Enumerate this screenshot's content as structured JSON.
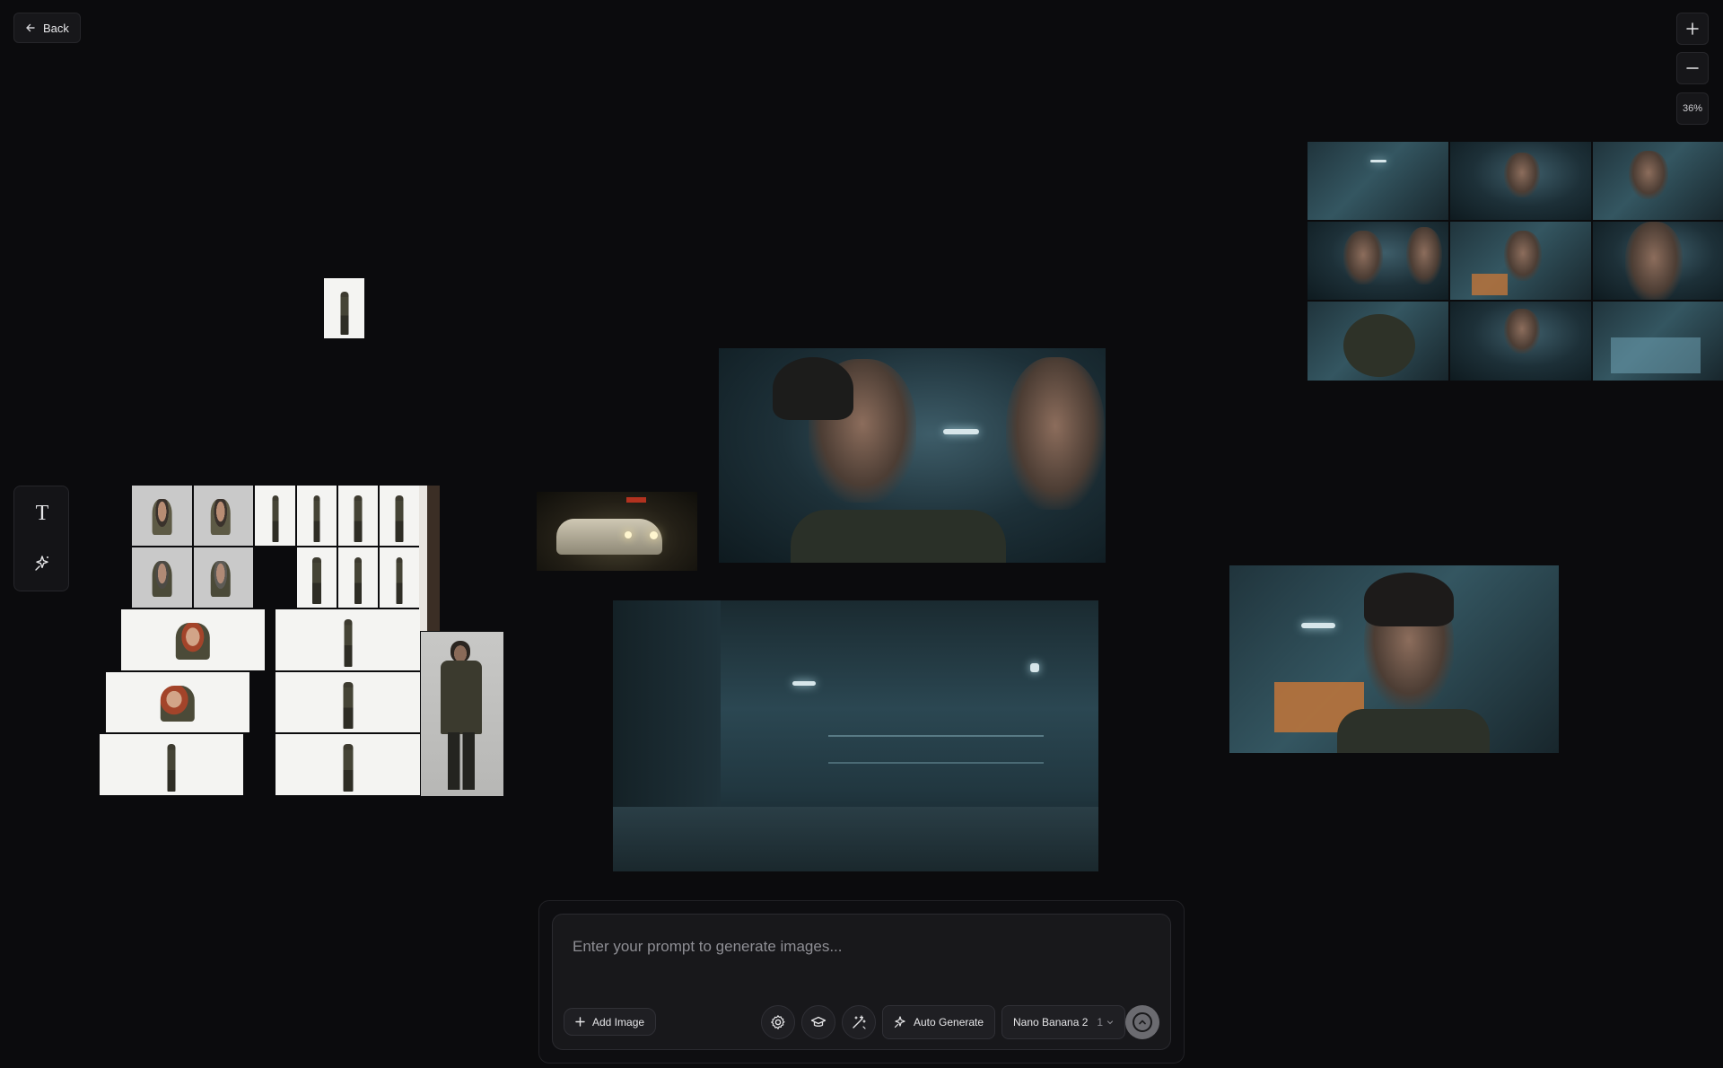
{
  "toolbar": {
    "back_label": "Back"
  },
  "zoom": {
    "level": "36%",
    "zoom_in_icon": "plus-icon",
    "zoom_out_icon": "minus-icon"
  },
  "tools": {
    "text_tool_glyph": "T",
    "text_tool_icon": "text-tool-icon",
    "ai_tool_icon": "sparkle-wand-icon"
  },
  "prompt": {
    "placeholder": "Enter your prompt to generate images...",
    "add_image_label": "Add Image",
    "settings_icon": "gear-icon",
    "learn_icon": "graduation-cap-icon",
    "enhance_icon": "magic-wand-icon",
    "auto_generate_label": "Auto Generate",
    "model_label": "Nano Banana 2",
    "count_label": "1",
    "send_icon": "arrow-up-circle-icon"
  },
  "colors": {
    "background": "#0b0b0d",
    "panel": "#18181b",
    "border": "#2a2a2f",
    "send_button": "#6b6b70"
  }
}
